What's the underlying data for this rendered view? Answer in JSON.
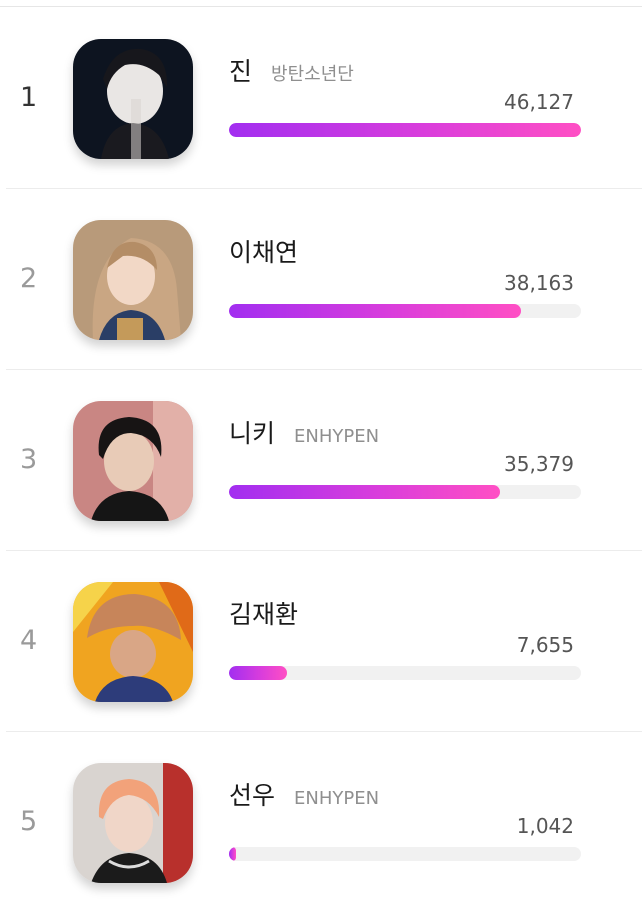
{
  "ranking": {
    "items": [
      {
        "rank": "1",
        "name": "진",
        "group": "방탄소년단",
        "votes": "46,127",
        "progress": 1.0,
        "avatar_icon": "profile-photo-jin",
        "avatar_colors": [
          "#0d1420",
          "#e9e6e4",
          "#1a1a1f"
        ]
      },
      {
        "rank": "2",
        "name": "이채연",
        "group": "",
        "votes": "38,163",
        "progress": 0.83,
        "avatar_icon": "profile-photo-lee-chaeyeon",
        "avatar_colors": [
          "#b89a7a",
          "#f2d8c6",
          "#2a3e66"
        ]
      },
      {
        "rank": "3",
        "name": "니키",
        "group": "ENHYPEN",
        "votes": "35,379",
        "progress": 0.77,
        "avatar_icon": "profile-photo-niki",
        "avatar_colors": [
          "#c98683",
          "#e8cbb7",
          "#171414"
        ]
      },
      {
        "rank": "4",
        "name": "김재환",
        "group": "",
        "votes": "7,655",
        "progress": 0.166,
        "avatar_icon": "profile-photo-kim-jaehwan",
        "avatar_colors": [
          "#f0a420",
          "#c7855a",
          "#2d3c7a"
        ]
      },
      {
        "rank": "5",
        "name": "선우",
        "group": "ENHYPEN",
        "votes": "1,042",
        "progress": 0.02,
        "avatar_icon": "profile-photo-sunoo",
        "avatar_colors": [
          "#d9d4d0",
          "#f2a27a",
          "#1b1b1b"
        ]
      }
    ]
  },
  "colors": {
    "bar_start": "#a22ef0",
    "bar_end": "#ff4fc4",
    "track": "#f1f1f1"
  }
}
